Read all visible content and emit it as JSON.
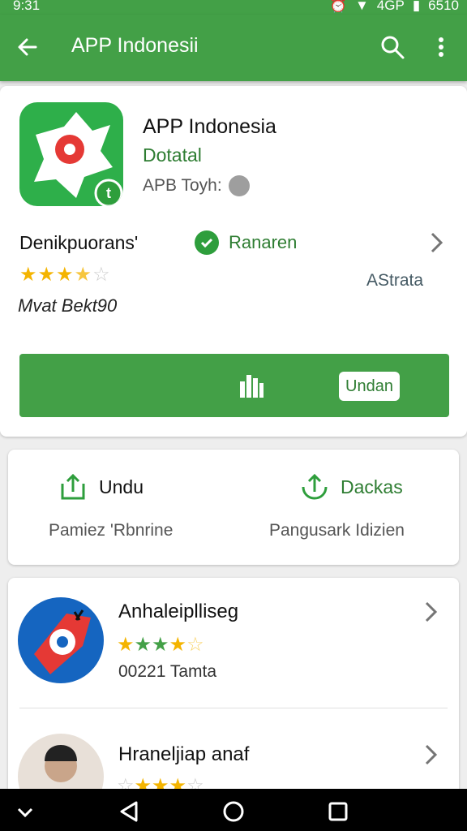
{
  "status_bar": {
    "time": "9:31",
    "network": "4GP",
    "clock": "6510"
  },
  "app_bar": {
    "title": "APP Indonesii",
    "back_icon": "arrow-left-icon",
    "search_icon": "search-icon",
    "menu_icon": "more-vert-icon"
  },
  "app": {
    "name": "APP Indonesia",
    "developer": "Dotatal",
    "subtitle": "APB Toyh:",
    "detail_label": "Denikpuorans'",
    "verified_label": "Ranaren",
    "rating": 3.5,
    "side_text": "AStrata",
    "meta": "Mvat Bekt90",
    "install_pill": "Undan"
  },
  "actions": {
    "left": {
      "label": "Undu",
      "sub": "Pamiez 'Rbnrine"
    },
    "right": {
      "label": "Dackas",
      "sub": "Pangusark Idizien"
    }
  },
  "list": [
    {
      "name": "Anhaleiplliseg",
      "rating": 3.5,
      "meta": "00221 Tamta"
    },
    {
      "name": "Hraneljiap anaf",
      "rating": 3.5,
      "meta": ""
    }
  ],
  "nav": {
    "icons": [
      "chevron-down-icon",
      "back-triangle-icon",
      "home-circle-icon",
      "recents-square-icon"
    ]
  },
  "colors": {
    "primary": "#43a047",
    "accent": "#2e7d32",
    "star": "#f4b400"
  }
}
